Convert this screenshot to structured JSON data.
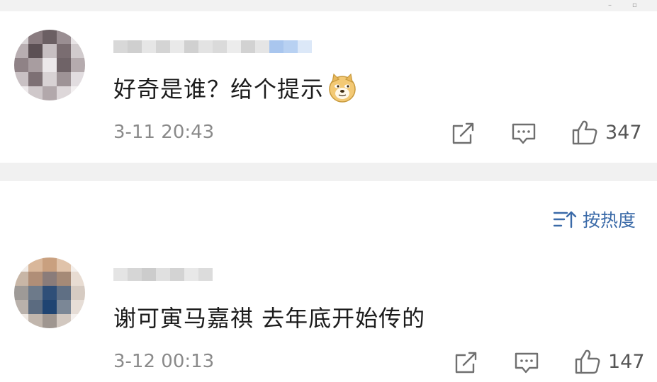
{
  "comments": [
    {
      "text": "好奇是谁？给个提示",
      "emoji": "doge-emoji",
      "time": "3-11 20:43",
      "likes": "347"
    },
    {
      "text": "谢可寅马嘉祺 去年底开始传的",
      "time": "3-12 00:13",
      "likes": "147"
    }
  ],
  "sort": {
    "label": "按热度"
  },
  "colors": {
    "accent": "#3a6aa8",
    "meta": "#8a8a8a",
    "divider": "#f1f1f1"
  }
}
